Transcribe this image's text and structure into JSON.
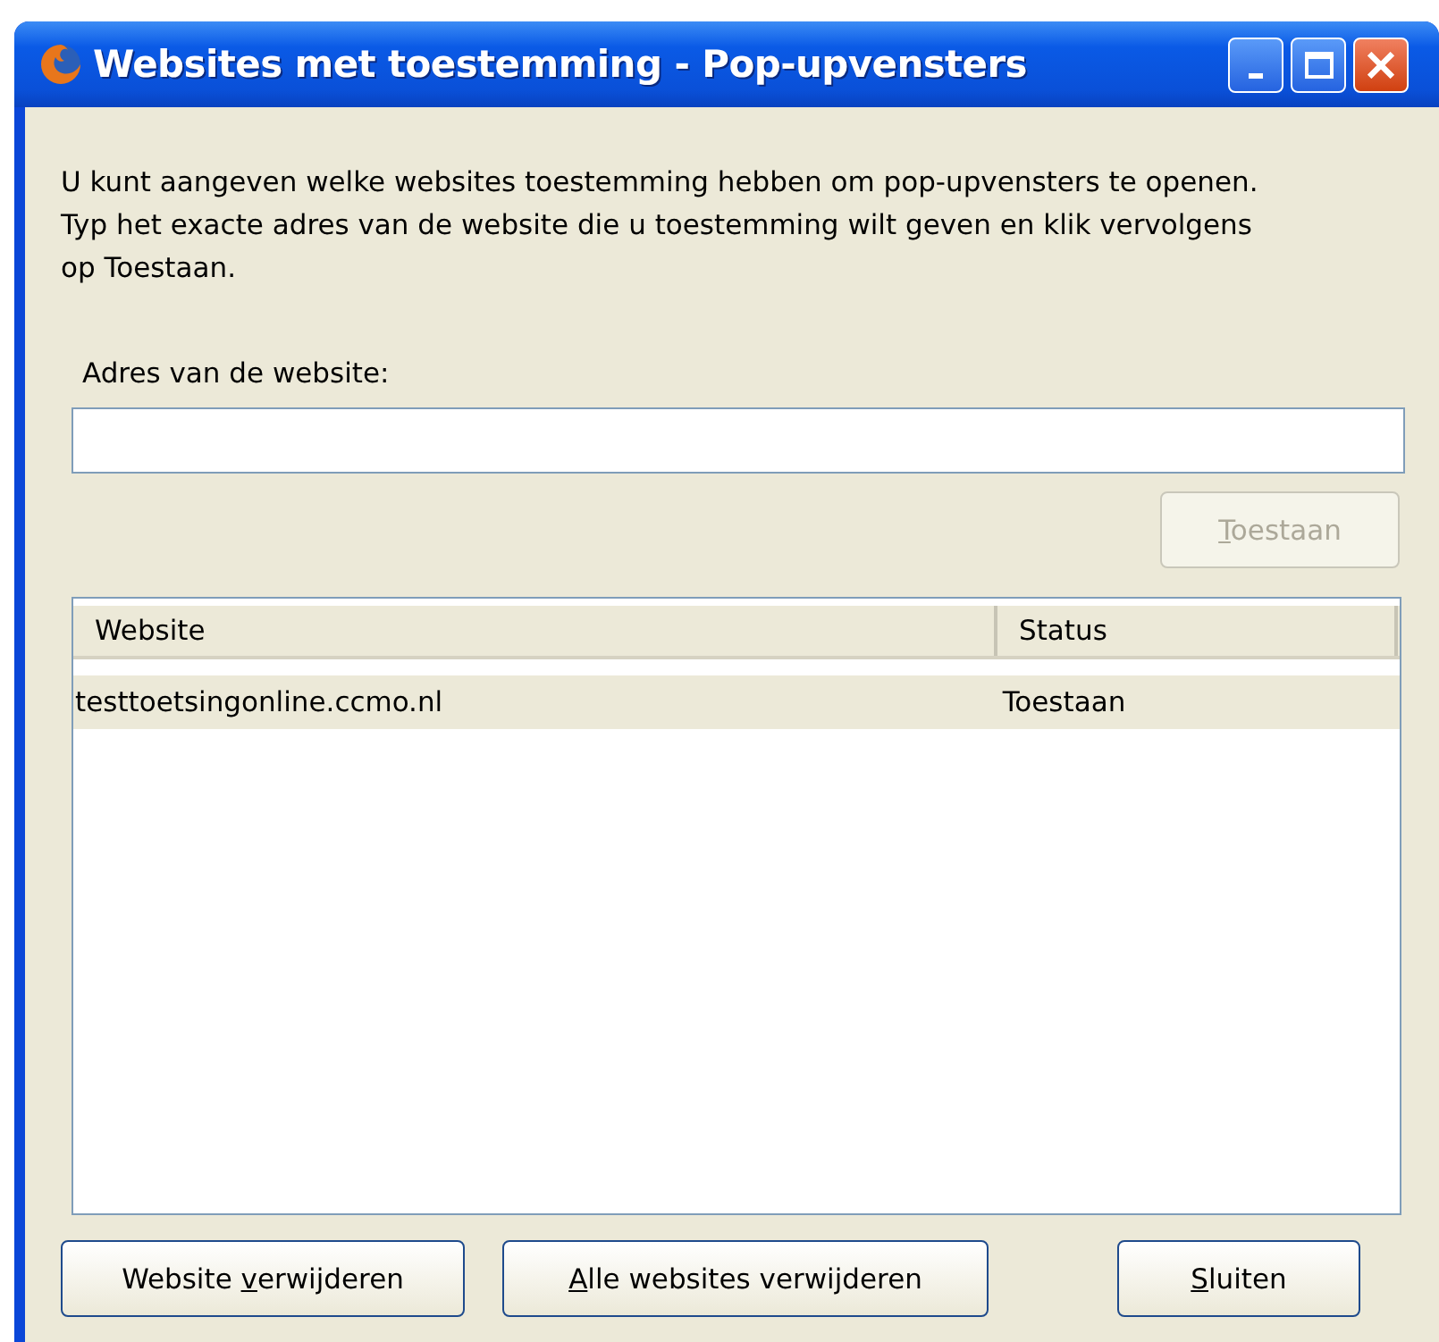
{
  "window": {
    "title": "Websites met toestemming - Pop-upvensters"
  },
  "description": "U kunt aangeven welke websites toestemming hebben om pop-upvensters te openen. Typ het exacte adres van de website die u toestemming wilt geven en klik vervolgens op Toestaan.",
  "address_field": {
    "label": "Adres van de website:"
  },
  "allow_button": {
    "accesskey": "T",
    "label_after": "oestaan",
    "disabled": true
  },
  "table": {
    "columns": [
      "Website",
      "Status"
    ],
    "rows": [
      {
        "cells": [
          "testtoetsingonline.ccmo.nl",
          "Toestaan"
        ],
        "selected": true
      }
    ]
  },
  "buttons": [
    {
      "label_before": "Website ",
      "accesskey": "v",
      "label_after": "erwijderen"
    },
    {
      "accesskey": "A",
      "label_after": "lle websites verwijderen"
    },
    {
      "accesskey": "S",
      "label_after": "luiten"
    }
  ]
}
